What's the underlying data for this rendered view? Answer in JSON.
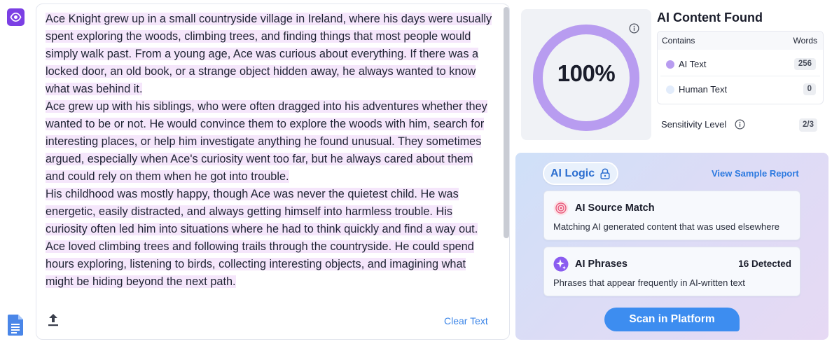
{
  "editor": {
    "paragraphs": [
      "Ace Knight grew up in a small countryside village in Ireland, where his days were usually spent exploring the woods, climbing trees, and finding things that most people would simply walk past. From a young age, Ace was curious about everything. If there was a locked door, an old book, or a strange object hidden away, he always wanted to know what was behind it.",
      "Ace grew up with his siblings, who were often dragged into his adventures whether they wanted to be or not. He would convince them to explore the woods with him, search for interesting places, or help him investigate anything he found unusual. They sometimes argued, especially when Ace's curiosity went too far, but he always cared about them and could rely on them when he got into trouble.",
      "His childhood was mostly happy, though Ace was never the quietest child. He was energetic, easily distracted, and always getting himself into harmless trouble. His curiosity often led him into situations where he had to think quickly and find a way out.",
      "Ace loved climbing trees and following trails through the countryside. He could spend hours exploring, listening to birds, collecting interesting objects, and imagining what might be hiding beyond the next path."
    ],
    "clear_label": "Clear Text",
    "upload_icon": "upload-icon"
  },
  "rail": {
    "top_icon": "eye-icon",
    "bottom_icon": "google-docs-icon"
  },
  "result": {
    "percent_label": "100%",
    "ai_fraction": 1.0,
    "title": "AI Content Found",
    "table_header_contains": "Contains",
    "table_header_words": "Words",
    "rows": [
      {
        "label": "AI Text",
        "words": "256",
        "color": "#b89cf0"
      },
      {
        "label": "Human Text",
        "words": "0",
        "color": "#e2ecfb"
      }
    ],
    "sensitivity_label": "Sensitivity Level",
    "sensitivity_value": "2/3",
    "gauge_color": "#b89cf0"
  },
  "ai_logic": {
    "title": "AI Logic",
    "sample_link": "View Sample Report",
    "cards": [
      {
        "title": "AI Source Match",
        "count": "",
        "desc": "Matching AI generated content that was used elsewhere",
        "icon": "target-icon"
      },
      {
        "title": "AI Phrases",
        "count": "16 Detected",
        "desc": "Phrases that appear frequently in AI-written text",
        "icon": "sparkle-icon"
      }
    ],
    "scan_label": "Scan in Platform"
  }
}
